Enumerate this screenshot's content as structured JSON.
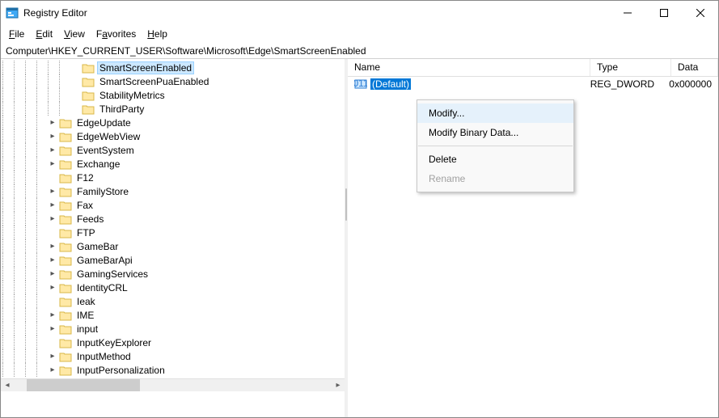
{
  "window": {
    "title": "Registry Editor"
  },
  "menubar": {
    "items": [
      {
        "label": "File",
        "accel": "F"
      },
      {
        "label": "Edit",
        "accel": "E"
      },
      {
        "label": "View",
        "accel": "V"
      },
      {
        "label": "Favorites",
        "accel": "a"
      },
      {
        "label": "Help",
        "accel": "H"
      }
    ]
  },
  "addressbar": {
    "path": "Computer\\HKEY_CURRENT_USER\\Software\\Microsoft\\Edge\\SmartScreenEnabled"
  },
  "tree": {
    "items": [
      {
        "depth": 6,
        "label": "SmartScreenEnabled",
        "selected": true,
        "expander": "none"
      },
      {
        "depth": 6,
        "label": "SmartScreenPuaEnabled",
        "expander": "none"
      },
      {
        "depth": 6,
        "label": "StabilityMetrics",
        "expander": "none"
      },
      {
        "depth": 6,
        "label": "ThirdParty",
        "expander": "none"
      },
      {
        "depth": 4,
        "label": "EdgeUpdate",
        "expander": "closed"
      },
      {
        "depth": 4,
        "label": "EdgeWebView",
        "expander": "closed"
      },
      {
        "depth": 4,
        "label": "EventSystem",
        "expander": "closed"
      },
      {
        "depth": 4,
        "label": "Exchange",
        "expander": "closed"
      },
      {
        "depth": 4,
        "label": "F12",
        "expander": "none"
      },
      {
        "depth": 4,
        "label": "FamilyStore",
        "expander": "closed"
      },
      {
        "depth": 4,
        "label": "Fax",
        "expander": "closed"
      },
      {
        "depth": 4,
        "label": "Feeds",
        "expander": "closed"
      },
      {
        "depth": 4,
        "label": "FTP",
        "expander": "none"
      },
      {
        "depth": 4,
        "label": "GameBar",
        "expander": "closed"
      },
      {
        "depth": 4,
        "label": "GameBarApi",
        "expander": "closed"
      },
      {
        "depth": 4,
        "label": "GamingServices",
        "expander": "closed"
      },
      {
        "depth": 4,
        "label": "IdentityCRL",
        "expander": "closed"
      },
      {
        "depth": 4,
        "label": "Ieak",
        "expander": "none"
      },
      {
        "depth": 4,
        "label": "IME",
        "expander": "closed"
      },
      {
        "depth": 4,
        "label": "input",
        "expander": "closed"
      },
      {
        "depth": 4,
        "label": "InputKeyExplorer",
        "expander": "none"
      },
      {
        "depth": 4,
        "label": "InputMethod",
        "expander": "closed"
      },
      {
        "depth": 4,
        "label": "InputPersonalization",
        "expander": "closed"
      }
    ]
  },
  "list": {
    "columns": {
      "name": "Name",
      "type": "Type",
      "data": "Data"
    },
    "rows": [
      {
        "name": "(Default)",
        "type": "REG_DWORD",
        "data": "0x000000",
        "selected": true,
        "icon": "dword"
      }
    ]
  },
  "context_menu": {
    "items": [
      {
        "label": "Modify...",
        "state": "highlight"
      },
      {
        "label": "Modify Binary Data...",
        "state": "normal"
      },
      {
        "sep": true
      },
      {
        "label": "Delete",
        "state": "normal"
      },
      {
        "label": "Rename",
        "state": "disabled"
      }
    ]
  }
}
